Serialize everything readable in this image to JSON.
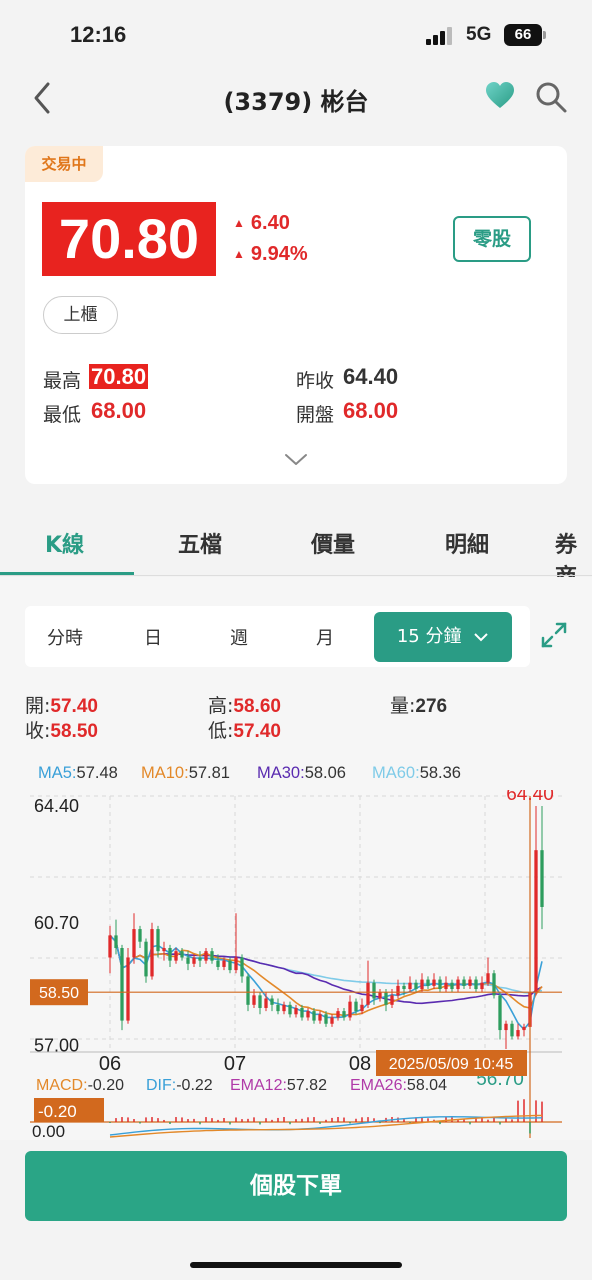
{
  "status": {
    "time": "12:16",
    "network": "5G",
    "battery": "66"
  },
  "nav": {
    "title": "(3379) 彬台"
  },
  "quote": {
    "status_badge": "交易中",
    "price": "70.80",
    "change": "6.40",
    "change_pct": "9.94%",
    "odd_lot_label": "零股",
    "market": "上櫃",
    "high_label": "最高",
    "high": "70.80",
    "low_label": "最低",
    "low": "68.00",
    "prev_close_label": "昨收",
    "prev_close": "64.40",
    "open_label": "開盤",
    "open": "68.00",
    "up_color": "#e0292a"
  },
  "tabs": [
    "K線",
    "五檔",
    "價量",
    "明細",
    "券商"
  ],
  "periods": {
    "items": [
      "分時",
      "日",
      "週",
      "月"
    ],
    "active": "15 分鐘"
  },
  "ohlc": {
    "open_label": "開:",
    "open": "57.40",
    "close_label": "收:",
    "close": "58.50",
    "high_label": "高:",
    "high": "58.60",
    "low_label": "低:",
    "low": "57.40",
    "vol_label": "量:",
    "vol": "276"
  },
  "ma": {
    "ma5_label": "MA5:",
    "ma5": "57.48",
    "ma10_label": "MA10:",
    "ma10": "57.81",
    "ma30_label": "MA30:",
    "ma30": "58.06",
    "ma60_label": "MA60:",
    "ma60": "58.36",
    "colors": {
      "ma5": "#3aa0d8",
      "ma10": "#e3892a",
      "ma30": "#5a2bb0",
      "ma60": "#7fcbe8"
    }
  },
  "chart_labels": {
    "y_ticks": [
      "64.40",
      "60.70",
      "57.00"
    ],
    "max_label": "64.40",
    "min_label": "56.70",
    "current_price_label": "58.50",
    "x_ticks": [
      "06",
      "07",
      "08"
    ],
    "crosshair_time": "2025/05/09 10:45"
  },
  "macd": {
    "macd_label": "MACD:",
    "macd": "-0.20",
    "dif_label": "DIF:",
    "dif": "-0.22",
    "ema12_label": "EMA12:",
    "ema12": "57.82",
    "ema26_label": "EMA26:",
    "ema26": "58.04",
    "current_label": "-0.20",
    "zero_label": "0.00"
  },
  "chart_data": {
    "type": "candlestick",
    "interval": "15 分鐘",
    "ylim": [
      56.7,
      64.4
    ],
    "x_ticks": [
      "06",
      "07",
      "08"
    ],
    "selected_bar": {
      "time": "2025/05/09 10:45",
      "open": 57.4,
      "high": 58.6,
      "low": 57.4,
      "close": 58.5,
      "volume": 276
    },
    "candles": [
      {
        "o": 59.6,
        "h": 60.6,
        "l": 59.1,
        "c": 60.3
      },
      {
        "o": 60.3,
        "h": 60.8,
        "l": 59.7,
        "c": 59.9
      },
      {
        "o": 59.9,
        "h": 60.0,
        "l": 57.3,
        "c": 57.6
      },
      {
        "o": 57.6,
        "h": 59.9,
        "l": 57.5,
        "c": 59.6
      },
      {
        "o": 59.6,
        "h": 61.0,
        "l": 59.4,
        "c": 60.5
      },
      {
        "o": 60.5,
        "h": 60.6,
        "l": 59.9,
        "c": 60.1
      },
      {
        "o": 60.1,
        "h": 60.2,
        "l": 58.8,
        "c": 59.0
      },
      {
        "o": 59.0,
        "h": 60.7,
        "l": 58.9,
        "c": 60.5
      },
      {
        "o": 60.5,
        "h": 60.6,
        "l": 59.6,
        "c": 59.8
      },
      {
        "o": 59.8,
        "h": 60.1,
        "l": 59.5,
        "c": 59.9
      },
      {
        "o": 59.9,
        "h": 60.0,
        "l": 59.3,
        "c": 59.5
      },
      {
        "o": 59.5,
        "h": 59.9,
        "l": 59.4,
        "c": 59.8
      },
      {
        "o": 59.8,
        "h": 59.9,
        "l": 59.5,
        "c": 59.6
      },
      {
        "o": 59.6,
        "h": 59.8,
        "l": 59.2,
        "c": 59.4
      },
      {
        "o": 59.4,
        "h": 59.7,
        "l": 59.3,
        "c": 59.6
      },
      {
        "o": 59.6,
        "h": 59.8,
        "l": 59.3,
        "c": 59.5
      },
      {
        "o": 59.5,
        "h": 59.9,
        "l": 59.4,
        "c": 59.8
      },
      {
        "o": 59.8,
        "h": 59.9,
        "l": 59.4,
        "c": 59.5
      },
      {
        "o": 59.5,
        "h": 59.7,
        "l": 59.2,
        "c": 59.3
      },
      {
        "o": 59.3,
        "h": 59.6,
        "l": 59.2,
        "c": 59.5
      },
      {
        "o": 59.5,
        "h": 59.6,
        "l": 59.1,
        "c": 59.2
      },
      {
        "o": 59.2,
        "h": 61.0,
        "l": 59.1,
        "c": 59.6
      },
      {
        "o": 59.6,
        "h": 59.7,
        "l": 58.8,
        "c": 59.0
      },
      {
        "o": 59.0,
        "h": 59.1,
        "l": 57.9,
        "c": 58.1
      },
      {
        "o": 58.1,
        "h": 58.6,
        "l": 58.0,
        "c": 58.4
      },
      {
        "o": 58.4,
        "h": 58.5,
        "l": 57.8,
        "c": 58.0
      },
      {
        "o": 58.0,
        "h": 58.5,
        "l": 57.9,
        "c": 58.3
      },
      {
        "o": 58.3,
        "h": 58.4,
        "l": 57.9,
        "c": 58.1
      },
      {
        "o": 58.1,
        "h": 58.3,
        "l": 57.8,
        "c": 57.9
      },
      {
        "o": 57.9,
        "h": 58.2,
        "l": 57.8,
        "c": 58.1
      },
      {
        "o": 58.1,
        "h": 58.2,
        "l": 57.7,
        "c": 57.8
      },
      {
        "o": 57.8,
        "h": 58.1,
        "l": 57.7,
        "c": 58.0
      },
      {
        "o": 58.0,
        "h": 58.1,
        "l": 57.6,
        "c": 57.7
      },
      {
        "o": 57.7,
        "h": 58.0,
        "l": 57.6,
        "c": 57.9
      },
      {
        "o": 57.9,
        "h": 58.0,
        "l": 57.5,
        "c": 57.6
      },
      {
        "o": 57.6,
        "h": 57.9,
        "l": 57.5,
        "c": 57.8
      },
      {
        "o": 57.8,
        "h": 57.9,
        "l": 57.4,
        "c": 57.5
      },
      {
        "o": 57.5,
        "h": 57.8,
        "l": 57.4,
        "c": 57.7
      },
      {
        "o": 57.7,
        "h": 58.0,
        "l": 57.6,
        "c": 57.9
      },
      {
        "o": 57.9,
        "h": 58.0,
        "l": 57.6,
        "c": 57.7
      },
      {
        "o": 57.7,
        "h": 58.4,
        "l": 57.6,
        "c": 58.2
      },
      {
        "o": 58.2,
        "h": 58.3,
        "l": 57.8,
        "c": 57.9
      },
      {
        "o": 57.9,
        "h": 58.3,
        "l": 57.8,
        "c": 58.1
      },
      {
        "o": 58.1,
        "h": 59.5,
        "l": 58.0,
        "c": 58.8
      },
      {
        "o": 58.8,
        "h": 58.9,
        "l": 58.1,
        "c": 58.3
      },
      {
        "o": 58.3,
        "h": 58.6,
        "l": 58.2,
        "c": 58.5
      },
      {
        "o": 58.5,
        "h": 58.6,
        "l": 57.9,
        "c": 58.1
      },
      {
        "o": 58.1,
        "h": 58.6,
        "l": 58.0,
        "c": 58.4
      },
      {
        "o": 58.4,
        "h": 58.9,
        "l": 58.3,
        "c": 58.7
      },
      {
        "o": 58.7,
        "h": 58.8,
        "l": 58.4,
        "c": 58.6
      },
      {
        "o": 58.6,
        "h": 59.0,
        "l": 58.5,
        "c": 58.8
      },
      {
        "o": 58.8,
        "h": 58.9,
        "l": 58.5,
        "c": 58.6
      },
      {
        "o": 58.6,
        "h": 59.1,
        "l": 58.5,
        "c": 58.9
      },
      {
        "o": 58.9,
        "h": 59.0,
        "l": 58.6,
        "c": 58.7
      },
      {
        "o": 58.7,
        "h": 59.1,
        "l": 58.6,
        "c": 58.9
      },
      {
        "o": 58.9,
        "h": 59.0,
        "l": 58.5,
        "c": 58.6
      },
      {
        "o": 58.6,
        "h": 59.0,
        "l": 58.5,
        "c": 58.8
      },
      {
        "o": 58.8,
        "h": 58.9,
        "l": 58.5,
        "c": 58.6
      },
      {
        "o": 58.6,
        "h": 59.0,
        "l": 58.5,
        "c": 58.9
      },
      {
        "o": 58.9,
        "h": 59.0,
        "l": 58.6,
        "c": 58.7
      },
      {
        "o": 58.7,
        "h": 59.0,
        "l": 58.6,
        "c": 58.9
      },
      {
        "o": 58.9,
        "h": 59.0,
        "l": 58.5,
        "c": 58.6
      },
      {
        "o": 58.6,
        "h": 59.0,
        "l": 58.5,
        "c": 58.8
      },
      {
        "o": 58.8,
        "h": 59.6,
        "l": 58.7,
        "c": 59.1
      },
      {
        "o": 59.1,
        "h": 59.2,
        "l": 58.3,
        "c": 58.4
      },
      {
        "o": 58.4,
        "h": 58.5,
        "l": 57.0,
        "c": 57.3
      },
      {
        "o": 57.3,
        "h": 57.6,
        "l": 56.7,
        "c": 57.5
      },
      {
        "o": 57.5,
        "h": 57.6,
        "l": 57.0,
        "c": 57.1
      },
      {
        "o": 57.1,
        "h": 57.5,
        "l": 57.0,
        "c": 57.3
      },
      {
        "o": 57.3,
        "h": 57.5,
        "l": 57.1,
        "c": 57.4
      },
      {
        "o": 57.4,
        "h": 58.6,
        "l": 57.4,
        "c": 58.5
      },
      {
        "o": 58.5,
        "h": 64.4,
        "l": 58.4,
        "c": 63.0
      },
      {
        "o": 63.0,
        "h": 64.4,
        "l": 60.5,
        "c": 61.2
      }
    ]
  }
}
